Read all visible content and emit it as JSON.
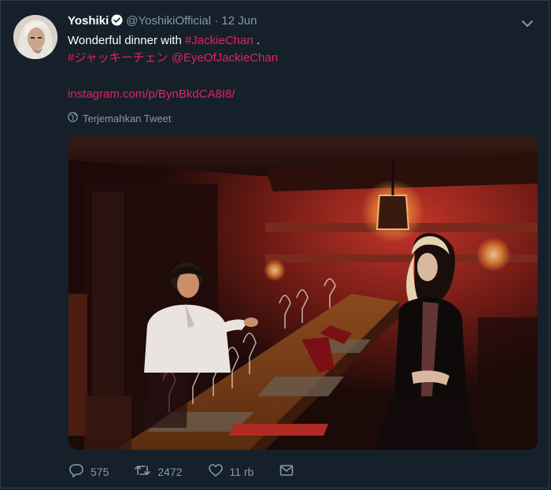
{
  "tweet": {
    "display_name": "Yoshiki",
    "handle": "@YoshikiOfficial",
    "separator": "·",
    "date": "12 Jun",
    "text_prefix": "Wonderful dinner with ",
    "hashtag_1": "#JackieChan",
    "text_suffix": " .",
    "hashtag_2": "#ジャッキーチェン",
    "mention": "@EyeOfJackieChan",
    "link": "instagram.com/p/BynBkdCA8I8/",
    "translate_label": "Terjemahkan Tweet"
  },
  "actions": {
    "reply_count": "575",
    "retweet_count": "2472",
    "like_count": "11 rb"
  },
  "colors": {
    "background": "#15202b",
    "link": "#e0245e",
    "muted": "#8899a6",
    "verified": "#ffffff"
  },
  "icons": [
    "verified-badge-icon",
    "chevron-down-icon",
    "globe-icon",
    "reply-icon",
    "retweet-icon",
    "like-icon",
    "share-icon"
  ]
}
